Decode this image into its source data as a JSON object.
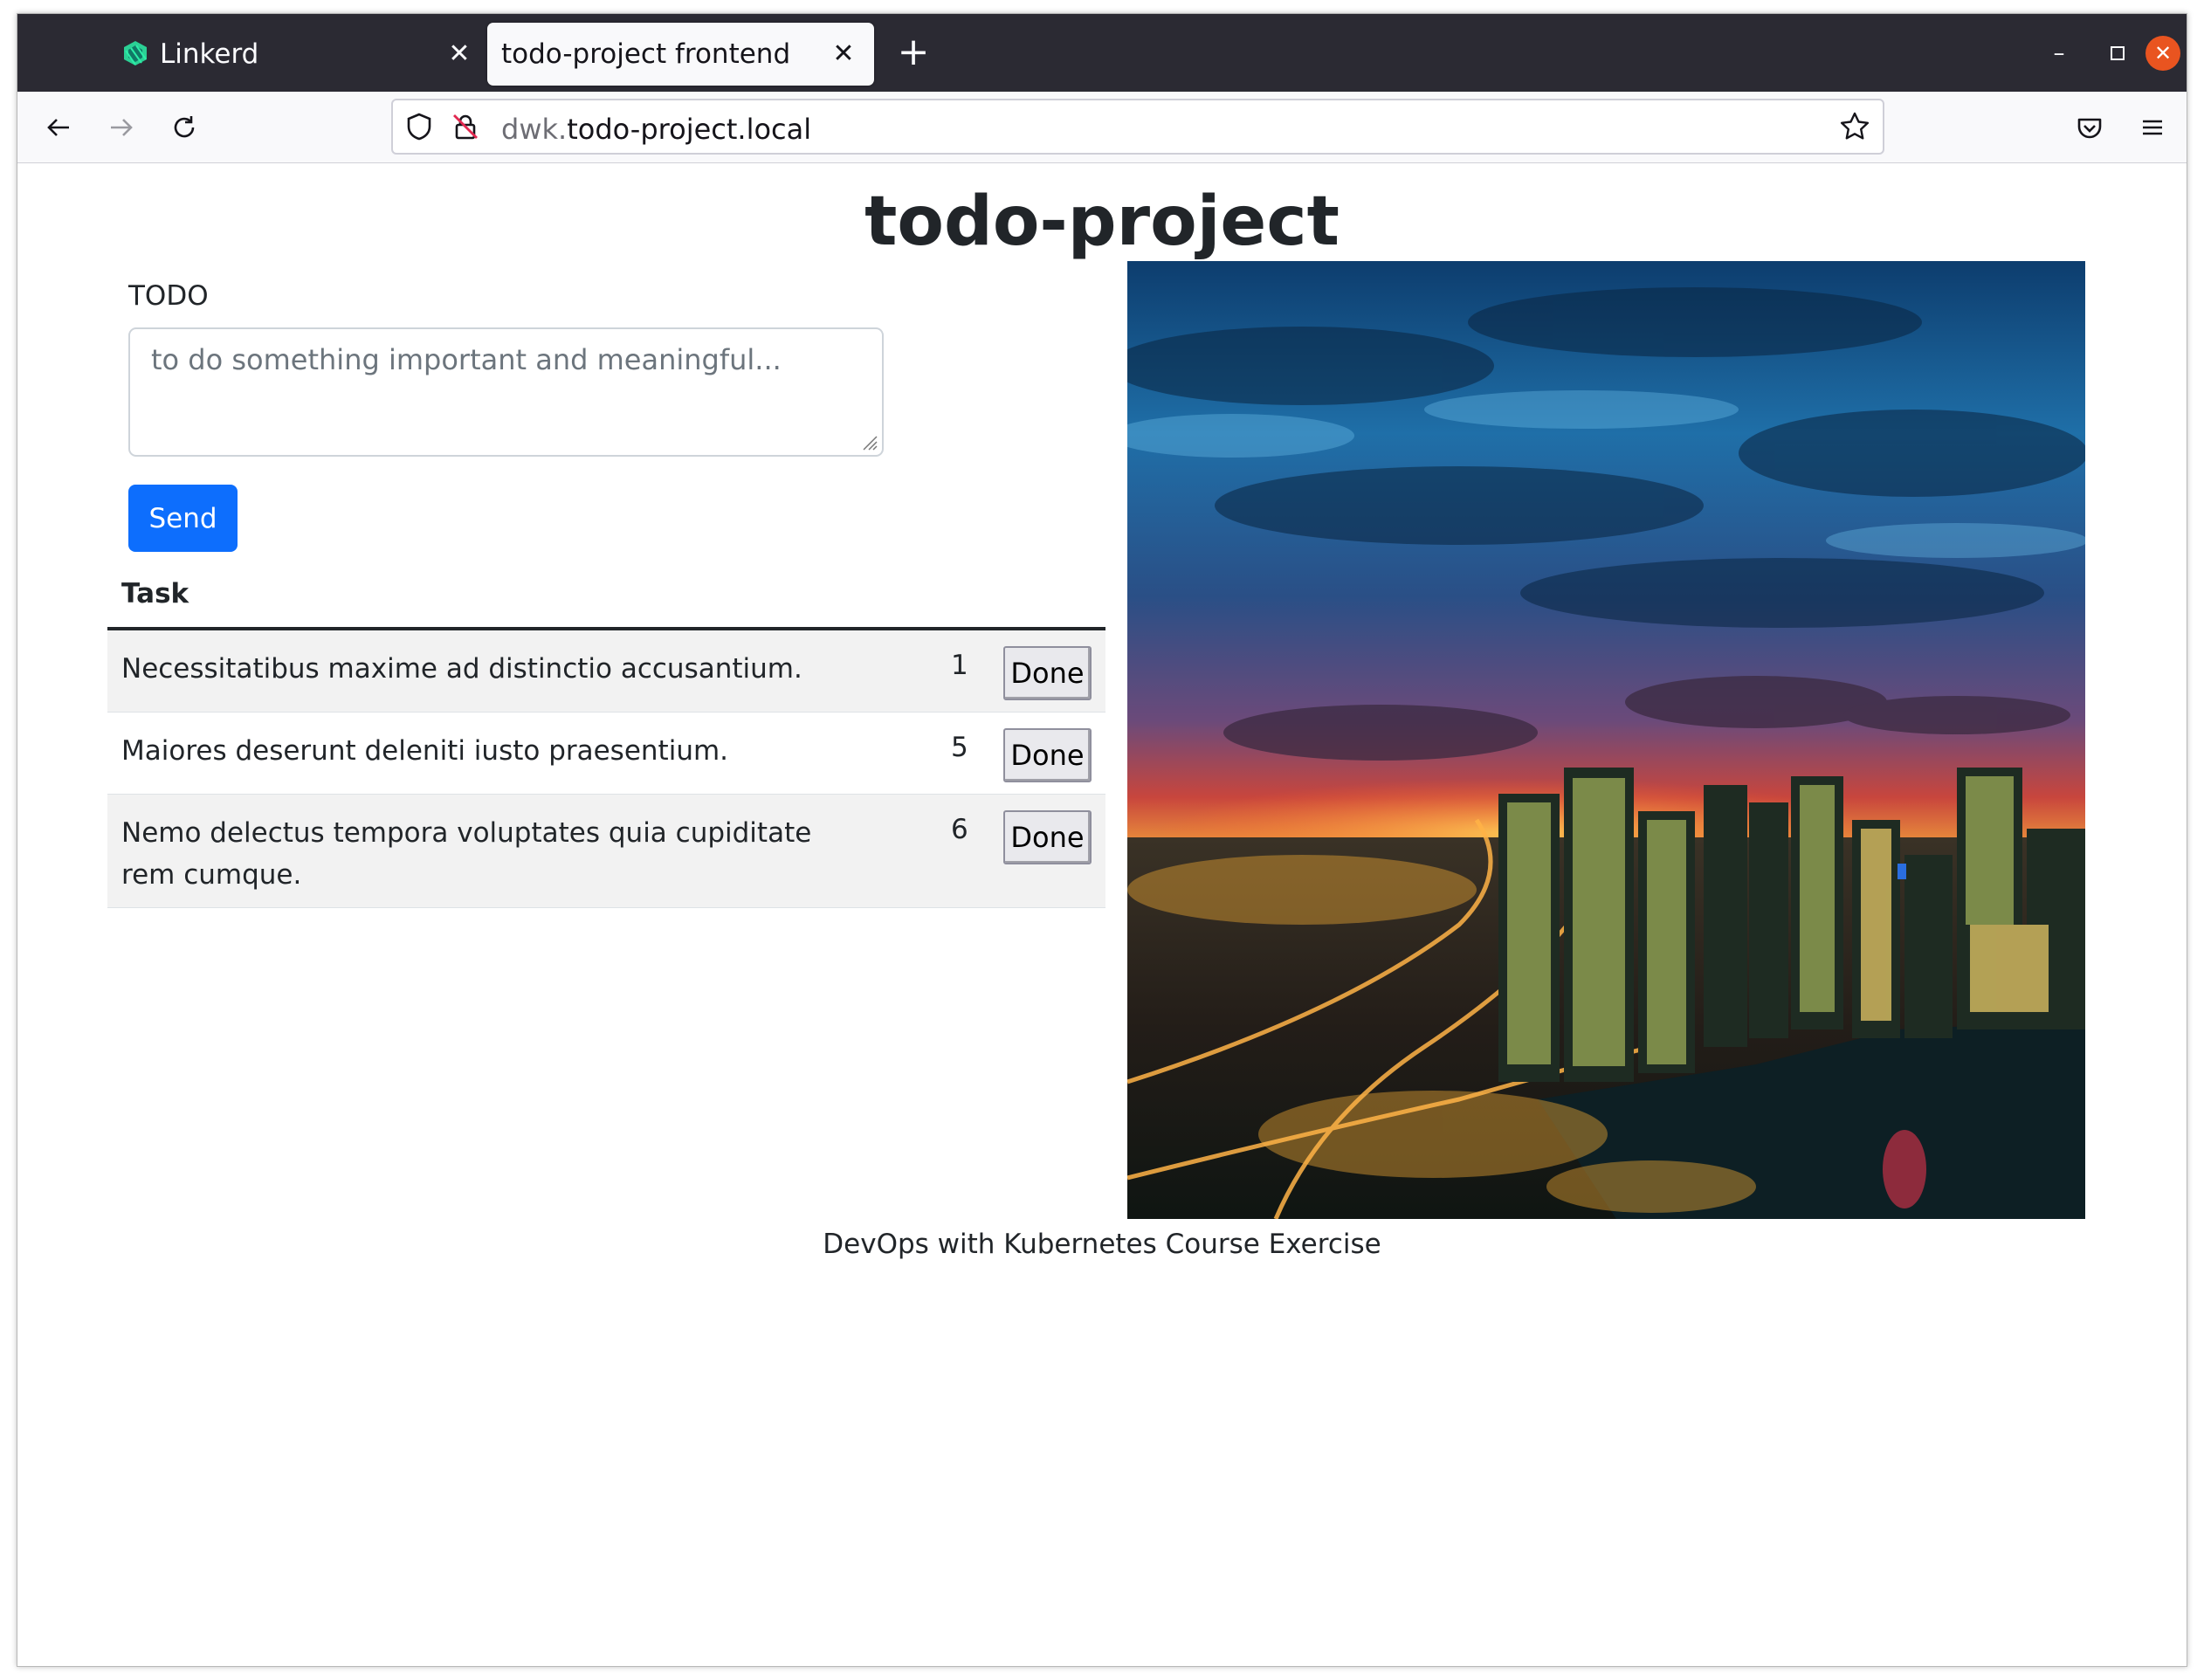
{
  "browser": {
    "tabs": [
      {
        "label": "Linkerd",
        "active": false
      },
      {
        "label": "todo-project frontend",
        "active": true
      }
    ],
    "url": {
      "subdomain": "dwk.",
      "domain": "todo-project.local"
    }
  },
  "page": {
    "title": "todo-project",
    "todo_label": "TODO",
    "todo_placeholder": "to do something important and meaningful...",
    "send_label": "Send",
    "table_header": "Task",
    "tasks": [
      {
        "text": "Necessitatibus maxime ad distinctio accusantium.",
        "id": "1",
        "button": "Done"
      },
      {
        "text": "Maiores deserunt deleniti iusto praesentium.",
        "id": "5",
        "button": "Done"
      },
      {
        "text": "Nemo delectus tempora voluptates quia cupiditate rem cumque.",
        "id": "6",
        "button": "Done"
      }
    ],
    "footer": "DevOps with Kubernetes Course Exercise"
  },
  "colors": {
    "tabbar": "#2b2a33",
    "primary_button": "#0d6efd",
    "window_close": "#e95420"
  }
}
